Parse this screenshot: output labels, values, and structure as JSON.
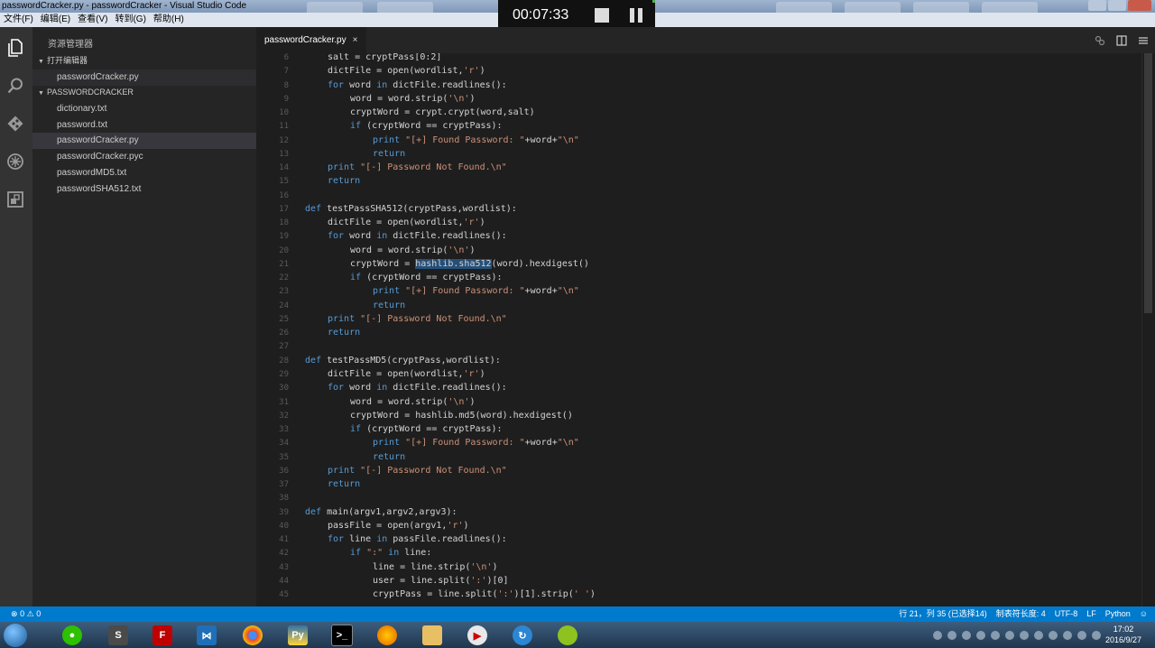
{
  "window": {
    "title": "passwordCracker.py - passwordCracker - Visual Studio Code"
  },
  "menu": [
    "文件(F)",
    "编辑(E)",
    "查看(V)",
    "转到(G)",
    "帮助(H)"
  ],
  "recorder": {
    "time": "00:07:33"
  },
  "activity_bar": [
    "explorer-icon",
    "search-icon",
    "git-icon",
    "debug-icon",
    "extensions-icon"
  ],
  "sidebar": {
    "title": "资源管理器",
    "open_editors_label": "打开编辑器",
    "open_editors": [
      "passwordCracker.py"
    ],
    "project_label": "PASSWORDCRACKER",
    "files": [
      {
        "name": "dictionary.txt",
        "selected": false
      },
      {
        "name": "password.txt",
        "selected": false
      },
      {
        "name": "passwordCracker.py",
        "selected": true
      },
      {
        "name": "passwordCracker.pyc",
        "selected": false
      },
      {
        "name": "passwordMD5.txt",
        "selected": false
      },
      {
        "name": "passwordSHA512.txt",
        "selected": false
      }
    ]
  },
  "tabs": [
    {
      "label": "passwordCracker.py",
      "close": "×"
    }
  ],
  "editor": {
    "lines": [
      {
        "n": 6,
        "indent": 1,
        "text": "salt = cryptPass[0:2]"
      },
      {
        "n": 7,
        "indent": 1,
        "text": "dictFile = open(wordlist,'r')"
      },
      {
        "n": 8,
        "indent": 1,
        "text": "for word in dictFile.readlines():"
      },
      {
        "n": 9,
        "indent": 2,
        "text": "word = word.strip('\\n')"
      },
      {
        "n": 10,
        "indent": 2,
        "text": "cryptWord = crypt.crypt(word,salt)"
      },
      {
        "n": 11,
        "indent": 2,
        "text": "if (cryptWord == cryptPass):"
      },
      {
        "n": 12,
        "indent": 3,
        "text": "print \"[+] Found Password: \"+word+\"\\n\""
      },
      {
        "n": 13,
        "indent": 3,
        "text": "return"
      },
      {
        "n": 14,
        "indent": 1,
        "text": "print \"[-] Password Not Found.\\n\""
      },
      {
        "n": 15,
        "indent": 1,
        "text": "return"
      },
      {
        "n": 16,
        "indent": 0,
        "text": ""
      },
      {
        "n": 17,
        "indent": 0,
        "text": "def testPassSHA512(cryptPass,wordlist):"
      },
      {
        "n": 18,
        "indent": 1,
        "text": "dictFile = open(wordlist,'r')"
      },
      {
        "n": 19,
        "indent": 1,
        "text": "for word in dictFile.readlines():"
      },
      {
        "n": 20,
        "indent": 2,
        "text": "word = word.strip('\\n')"
      },
      {
        "n": 21,
        "indent": 2,
        "text": "cryptWord = hashlib.sha512(word).hexdigest()"
      },
      {
        "n": 22,
        "indent": 2,
        "text": "if (cryptWord == cryptPass):"
      },
      {
        "n": 23,
        "indent": 3,
        "text": "print \"[+] Found Password: \"+word+\"\\n\""
      },
      {
        "n": 24,
        "indent": 3,
        "text": "return"
      },
      {
        "n": 25,
        "indent": 1,
        "text": "print \"[-] Password Not Found.\\n\""
      },
      {
        "n": 26,
        "indent": 1,
        "text": "return"
      },
      {
        "n": 27,
        "indent": 0,
        "text": ""
      },
      {
        "n": 28,
        "indent": 0,
        "text": "def testPassMD5(cryptPass,wordlist):"
      },
      {
        "n": 29,
        "indent": 1,
        "text": "dictFile = open(wordlist,'r')"
      },
      {
        "n": 30,
        "indent": 1,
        "text": "for word in dictFile.readlines():"
      },
      {
        "n": 31,
        "indent": 2,
        "text": "word = word.strip('\\n')"
      },
      {
        "n": 32,
        "indent": 2,
        "text": "cryptWord = hashlib.md5(word).hexdigest()"
      },
      {
        "n": 33,
        "indent": 2,
        "text": "if (cryptWord == cryptPass):"
      },
      {
        "n": 34,
        "indent": 3,
        "text": "print \"[+] Found Password: \"+word+\"\\n\""
      },
      {
        "n": 35,
        "indent": 3,
        "text": "return"
      },
      {
        "n": 36,
        "indent": 1,
        "text": "print \"[-] Password Not Found.\\n\""
      },
      {
        "n": 37,
        "indent": 1,
        "text": "return"
      },
      {
        "n": 38,
        "indent": 0,
        "text": ""
      },
      {
        "n": 39,
        "indent": 0,
        "text": "def main(argv1,argv2,argv3):"
      },
      {
        "n": 40,
        "indent": 1,
        "text": "passFile = open(argv1,'r')"
      },
      {
        "n": 41,
        "indent": 1,
        "text": "for line in passFile.readlines():"
      },
      {
        "n": 42,
        "indent": 2,
        "text": "if \":\" in line:"
      },
      {
        "n": 43,
        "indent": 3,
        "text": "line = line.strip('\\n')"
      },
      {
        "n": 44,
        "indent": 3,
        "text": "user = line.split(':')[0]"
      },
      {
        "n": 45,
        "indent": 3,
        "text": "cryptPass = line.split(':')[1].strip(' ')"
      }
    ],
    "selection": {
      "line": 21,
      "text": "hashlib.sha512"
    }
  },
  "status": {
    "errors": "0",
    "warnings": "0",
    "position": "行 21，列 35 (已选择14)",
    "tab_size": "制表符长度: 4",
    "encoding": "UTF-8",
    "eol": "LF",
    "language": "Python"
  },
  "taskbar": {
    "apps": [
      "wechat-icon",
      "sublime-icon",
      "filezilla-icon",
      "vscode-icon",
      "chrome-icon",
      "python-icon",
      "cmd-icon",
      "firefox-icon",
      "explorer-folder-icon",
      "media-player-icon",
      "vm-icon",
      "app-icon"
    ],
    "time": "17:02",
    "date": "2016/9/27"
  },
  "colors": {
    "accent": "#007acc",
    "keyword": "#569cd6",
    "string": "#ce9178"
  }
}
